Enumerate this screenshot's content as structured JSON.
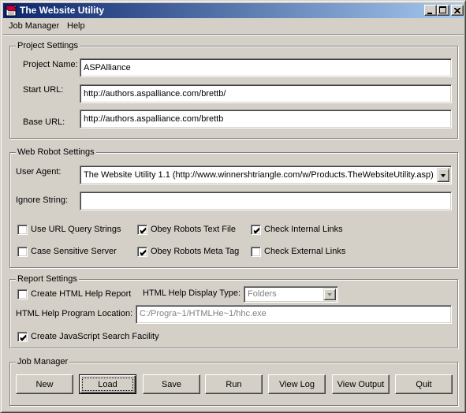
{
  "window": {
    "title": "The Website Utility",
    "controls": [
      "minimize",
      "maximize",
      "close"
    ]
  },
  "menu": {
    "items": [
      "Job Manager",
      "Help"
    ]
  },
  "project_settings": {
    "group_label": "Project Settings",
    "project_name_label": "Project Name:",
    "project_name_value": "ASPAlliance",
    "start_url_label": "Start URL:",
    "start_url_value": "http://authors.aspalliance.com/brettb/",
    "base_url_label": "Base URL:",
    "base_url_value": "http://authors.aspalliance.com/brettb"
  },
  "web_robot_settings": {
    "group_label": "Web Robot Settings",
    "user_agent_label": "User Agent:",
    "user_agent_value": "The Website Utility 1.1 (http://www.winnershtriangle.com/w/Products.TheWebsiteUtility.asp)",
    "ignore_string_label": "Ignore String:",
    "ignore_string_value": "",
    "checkboxes": [
      {
        "label": "Use URL Query Strings",
        "checked": false
      },
      {
        "label": "Obey Robots Text File",
        "checked": true
      },
      {
        "label": "Check Internal Links",
        "checked": true
      },
      {
        "label": "Case Sensitive Server",
        "checked": false
      },
      {
        "label": "Obey Robots Meta Tag",
        "checked": true
      },
      {
        "label": "Check External Links",
        "checked": false
      }
    ]
  },
  "report_settings": {
    "group_label": "Report Settings",
    "create_html_help": {
      "label": "Create HTML Help Report",
      "checked": false
    },
    "display_type_label": "HTML Help Display Type:",
    "display_type_value": "Folders",
    "program_location_label": "HTML Help Program Location:",
    "program_location_value": "C:/Progra~1/HTMLHe~1/hhc.exe",
    "create_js_search": {
      "label": "Create JavaScript Search Facility",
      "checked": true
    }
  },
  "job_manager": {
    "group_label": "Job Manager",
    "buttons": [
      "New",
      "Load",
      "Save",
      "Run",
      "View Log",
      "View Output",
      "Quit"
    ],
    "default_button": "Load"
  }
}
